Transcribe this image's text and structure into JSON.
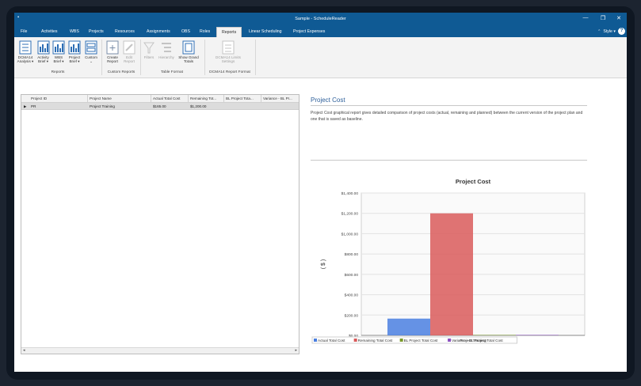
{
  "window": {
    "title": "Sample - ScheduleReader",
    "app_icon": "app-icon",
    "controls": [
      "—",
      "❐",
      "✕"
    ]
  },
  "menu": {
    "tabs": [
      "File",
      "Activities",
      "WBS",
      "Projects",
      "Resources",
      "Assignments",
      "OBS",
      "Roles",
      "Reports",
      "Linear Scheduling",
      "Project Expenses"
    ],
    "active": "Reports",
    "style_label": "Style",
    "collapse_glyph": "⌃"
  },
  "ribbon": {
    "groups": [
      {
        "label": "Reports",
        "buttons": [
          {
            "label": "DCMA14 Analysis",
            "icon": "report-list-icon",
            "enabled": true
          },
          {
            "label": "Activity Brief",
            "icon": "bar-report-icon",
            "enabled": true
          },
          {
            "label": "WBS Brief",
            "icon": "bar-report-icon",
            "enabled": true
          },
          {
            "label": "Project Brief",
            "icon": "bar-report-icon",
            "enabled": true
          },
          {
            "label": "Custom",
            "icon": "custom-report-icon",
            "enabled": true
          }
        ]
      },
      {
        "label": "Custom Reports",
        "buttons": [
          {
            "label": "Create Report",
            "icon": "create-report-icon",
            "enabled": true
          },
          {
            "label": "Edit Report",
            "icon": "edit-report-icon",
            "enabled": false
          }
        ]
      },
      {
        "label": "Table Format",
        "buttons": [
          {
            "label": "Filters",
            "icon": "filter-icon",
            "enabled": false
          },
          {
            "label": "Hierarchy",
            "icon": "hierarchy-icon",
            "enabled": false
          },
          {
            "label": "Show Grand Totals",
            "icon": "grand-totals-icon",
            "enabled": true
          }
        ]
      },
      {
        "label": "DCMA14 Report Format",
        "buttons": [
          {
            "label": "DCMA14 Limits Settings",
            "icon": "limits-settings-icon",
            "enabled": false
          }
        ]
      }
    ]
  },
  "grid": {
    "columns": [
      "Project ID",
      "Project Name",
      "Actual Total Cost",
      "Remaining Tot...",
      "BL Project Tota...",
      "Variance - BL Pr..."
    ],
    "rows": [
      {
        "expander": "▶",
        "cells": [
          "PR",
          "Project Training",
          "$165.00",
          "$1,200.00",
          "",
          ""
        ]
      }
    ],
    "scroll_left": "◂",
    "scroll_right": "▸"
  },
  "report": {
    "title": "Project Cost",
    "description": "Project Cost graphical report gives detailed comparison of project costs (actual, remaining and planned) between the current version of the project plan and one that is saved as baseline."
  },
  "chart_data": {
    "type": "bar",
    "title": "Project Cost",
    "ylabel": "( $ )",
    "xlabel": "",
    "categories": [
      "Project Training"
    ],
    "series": [
      {
        "name": "Actual Total Cost",
        "values": [
          165
        ],
        "color": "#4a7fe0"
      },
      {
        "name": "Remaining Total Cost",
        "values": [
          1200
        ],
        "color": "#d95a5a"
      },
      {
        "name": "BL Project Total Cost",
        "values": [
          0
        ],
        "color": "#7a9a2a"
      },
      {
        "name": "Variance - BL Project Total Cost",
        "values": [
          0
        ],
        "color": "#8a4fc0"
      }
    ],
    "ylim": [
      0,
      1400
    ],
    "yticks": [
      "$0.00",
      "$200.00",
      "$400.00",
      "$600.00",
      "$800.00",
      "$1,000.00",
      "$1,200.00",
      "$1,400.00"
    ],
    "grid": true,
    "legend_position": "bottom"
  }
}
